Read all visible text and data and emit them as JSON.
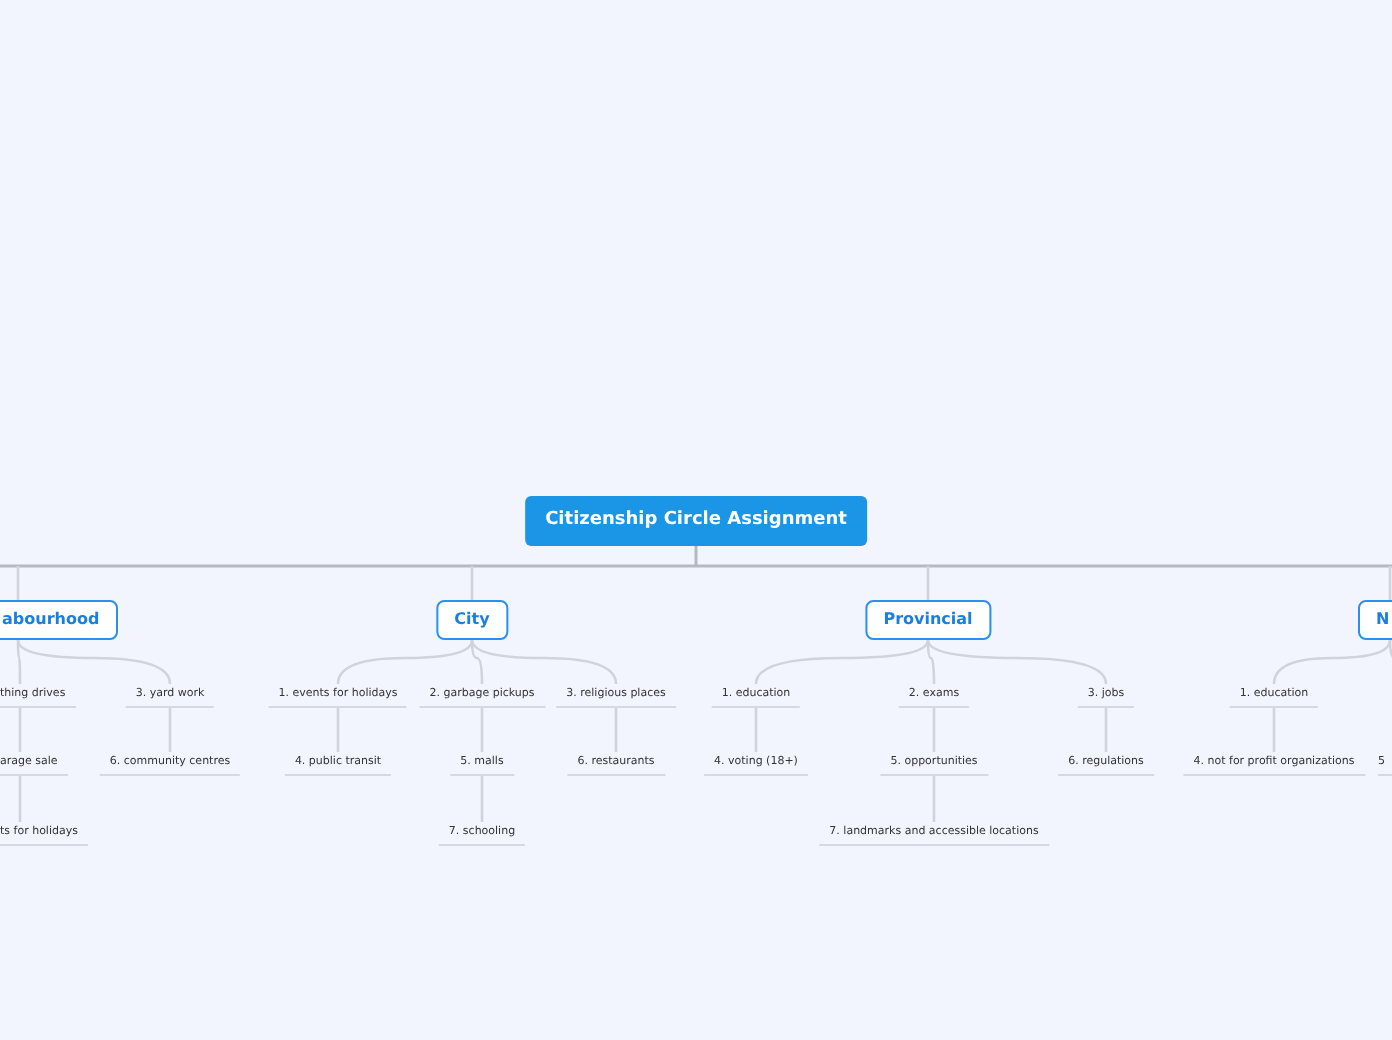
{
  "root": {
    "label": "Citizenship Circle Assignment"
  },
  "branches": [
    {
      "label": "abourhood",
      "children": [
        {
          "label": "thing drives",
          "children": [
            {
              "label": "arage sale",
              "children": [
                {
                  "label": "ts for holidays"
                }
              ]
            }
          ]
        },
        {
          "label": "3. yard work",
          "children": [
            {
              "label": "6. community centres"
            }
          ]
        }
      ]
    },
    {
      "label": "City",
      "children": [
        {
          "label": "1.  events for holidays",
          "children": [
            {
              "label": "4. public transit"
            }
          ]
        },
        {
          "label": "2. garbage pickups",
          "children": [
            {
              "label": "5. malls",
              "children": [
                {
                  "label": "7. schooling"
                }
              ]
            }
          ]
        },
        {
          "label": "3. religious places",
          "children": [
            {
              "label": "6. restaurants"
            }
          ]
        }
      ]
    },
    {
      "label": "Provincial",
      "children": [
        {
          "label": "1. education",
          "children": [
            {
              "label": "4. voting (18+)"
            }
          ]
        },
        {
          "label": "2. exams",
          "children": [
            {
              "label": "5. opportunities",
              "children": [
                {
                  "label": "7. landmarks and accessible locations"
                }
              ]
            }
          ]
        },
        {
          "label": "3. jobs",
          "children": [
            {
              "label": "6. regulations"
            }
          ]
        }
      ]
    },
    {
      "label": "N",
      "children": [
        {
          "label": "1. education",
          "children": [
            {
              "label": "4. not for profit organizations"
            }
          ]
        },
        {
          "children": [
            {
              "label": "5"
            }
          ]
        }
      ]
    }
  ]
}
